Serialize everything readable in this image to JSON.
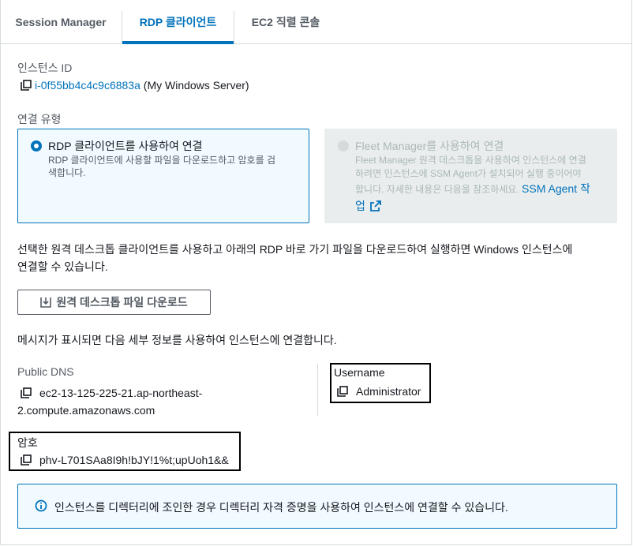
{
  "tabs": [
    {
      "label": "Session Manager"
    },
    {
      "label": "RDP 클라이언트"
    },
    {
      "label": "EC2 직렬 콘솔"
    }
  ],
  "instance": {
    "label": "인스턴스 ID",
    "id": "i-0f55bb4c4c9c6883a",
    "name": "(My Windows Server)"
  },
  "connection_type": {
    "label": "연결 유형",
    "rdp": {
      "title": "RDP 클라이언트를 사용하여 연결",
      "desc_line1": "RDP 클라이언트에 사용할 파일을 다운로드하고 암호를 검",
      "desc_line2": "색합니다."
    },
    "fleet": {
      "title": "Fleet Manager를 사용하여 연결",
      "desc_line1": "Fleet Manager 원격 데스크톱을 사용하여 인스턴스에 연결",
      "desc_line2": "하려면 인스턴스에 SSM Agent가 설치되어 실행 중이어야",
      "desc_line3": "합니다. 자세한 내용은 다음을 참조하세요.",
      "link_part1": "SSM Agent 작",
      "link_part2": "업"
    }
  },
  "instructions": {
    "line1": "선택한 원격 데스크톱 클라이언트를 사용하고 아래의 RDP 바로 가기 파일을 다운로드하여 실행하면 Windows 인스턴스에",
    "line2": "연결할 수 있습니다."
  },
  "download_button": "원격 데스크톱 파일 다운로드",
  "prompt_text": "메시지가 표시되면 다음 세부 정보를 사용하여 인스턴스에 연결합니다.",
  "public_dns": {
    "label": "Public DNS",
    "value_line1": "ec2-13-125-225-21.ap-northeast-",
    "value_line2": "2.compute.amazonaws.com"
  },
  "username": {
    "label": "Username",
    "value": "Administrator"
  },
  "password": {
    "label": "암호",
    "value": "phv-L701SAa8I9h!bJY!1%t;upUoh1&&"
  },
  "info": {
    "text": "인스턴스를 디렉터리에 조인한 경우 디렉터리 자격 증명을 사용하여 인스턴스에 연결할 수 있습니다."
  },
  "colors": {
    "accent": "#0073bb",
    "selected_bg": "#f1faff",
    "disabled_bg": "#eaeded"
  }
}
